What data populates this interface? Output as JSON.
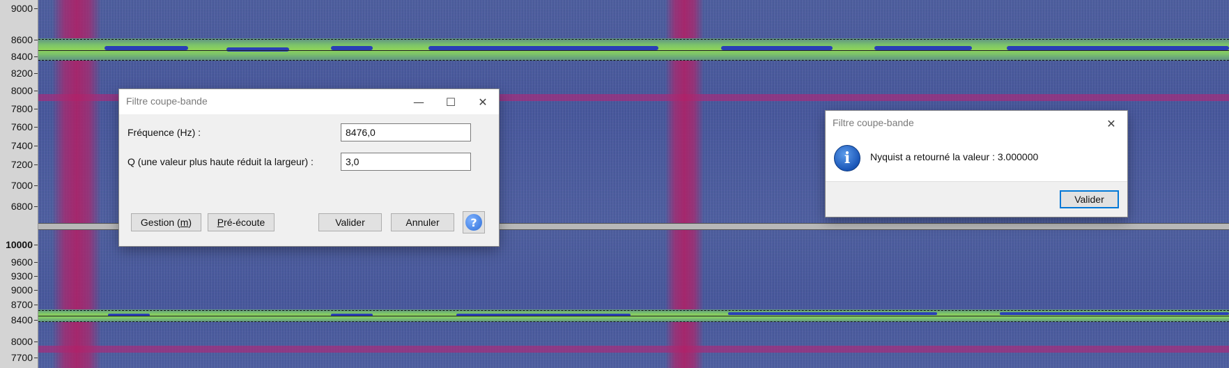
{
  "ruler_top": {
    "ticks": [
      "9000",
      "8600",
      "8400",
      "8200",
      "8000",
      "7800",
      "7600",
      "7400",
      "7200",
      "7000",
      "6800"
    ]
  },
  "ruler_bottom": {
    "ticks": [
      "10000",
      "9600",
      "9300",
      "9000",
      "8700",
      "8400",
      "8000",
      "7700"
    ]
  },
  "colors": {
    "background_blue": "#4a5a9a",
    "band_green": "#8fd35a",
    "stripe_pink": "#b42878",
    "accent": "#0078d7"
  },
  "dialog_main": {
    "title": "Filtre coupe-bande",
    "frequency_label": "Fréquence (Hz) :",
    "frequency_value": "8476,0",
    "q_label": "Q (une valeur plus haute réduit la largeur) :",
    "q_value": "3,0",
    "manage_label_prefix": "Gestion (",
    "manage_label_key": "m",
    "manage_label_suffix": ")",
    "preview_label_key": "P",
    "preview_label_rest": "ré-écoute",
    "ok_label": "Valider",
    "cancel_label": "Annuler",
    "help_glyph": "?",
    "minimize_glyph": "—",
    "maximize_glyph": "☐",
    "close_glyph": "✕"
  },
  "dialog_message": {
    "title": "Filtre coupe-bande",
    "message": "Nyquist a retourné la valeur : 3.000000",
    "ok_label": "Valider",
    "close_glyph": "✕",
    "icon_glyph": "i"
  }
}
